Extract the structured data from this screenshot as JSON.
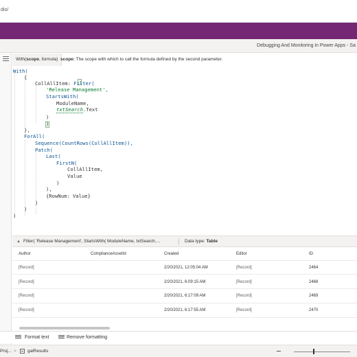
{
  "browser": {
    "url_fragment": "dio/"
  },
  "window": {
    "title": "Debugging And Monitoring in Power Apps - Sa"
  },
  "hint": {
    "signature_prefix": "With(",
    "signature_param": "scope",
    "signature_suffix": ", formula)",
    "desc_label": "scope:",
    "desc_text": " The scope with which to call the formula defined by the second parameter."
  },
  "code": {
    "l0": "With(",
    "l1": "{",
    "l2a": "CollAllItem: ",
    "l2b": "Filter(",
    "l3": "'Release Management',",
    "l4": "StartsWith(",
    "l5": "ModuleName,",
    "l6a": "txtSearch",
    "l6b": ".Text",
    "l7": ")",
    "l8": ")",
    "l9": "},",
    "l10": "ForAll(",
    "l11": "Sequence(CountRows(CollAllItem)),",
    "l12": "Patch(",
    "l13": "Last(",
    "l14": "FirstN(",
    "l15": "CollAllItem,",
    "l16": "Value",
    "l17": ")",
    "l18": "),",
    "l19": "{RowNum: Value}",
    "l20": ")",
    "l21": ")",
    "l22": ")"
  },
  "result": {
    "expression": "Filter( 'Release Management', StartsWith( ModuleName, txtSearch....",
    "datatype_label": "Data type: ",
    "datatype_value": "Table"
  },
  "table": {
    "columns": [
      "Author",
      "ComplianceAssetId",
      "Created",
      "Editor",
      "ID"
    ],
    "rows": [
      [
        "[Record]",
        "",
        "2/20/2021, 12:05:04 AM",
        "[Record]",
        "2464"
      ],
      [
        "[Record]",
        "",
        "2/20/2021, 6:09:15 AM",
        "[Record]",
        "2468"
      ],
      [
        "[Record]",
        "",
        "2/20/2021, 6:17:09 AM",
        "[Record]",
        "2469"
      ],
      [
        "[Record]",
        "",
        "2/20/2021, 6:17:55 AM",
        "[Record]",
        "2470"
      ]
    ]
  },
  "format_bar": {
    "format_text": "Format text",
    "remove_formatting": "Remove formatting"
  },
  "status": {
    "project": "Proj...",
    "separator": ">",
    "control": "galResults"
  }
}
